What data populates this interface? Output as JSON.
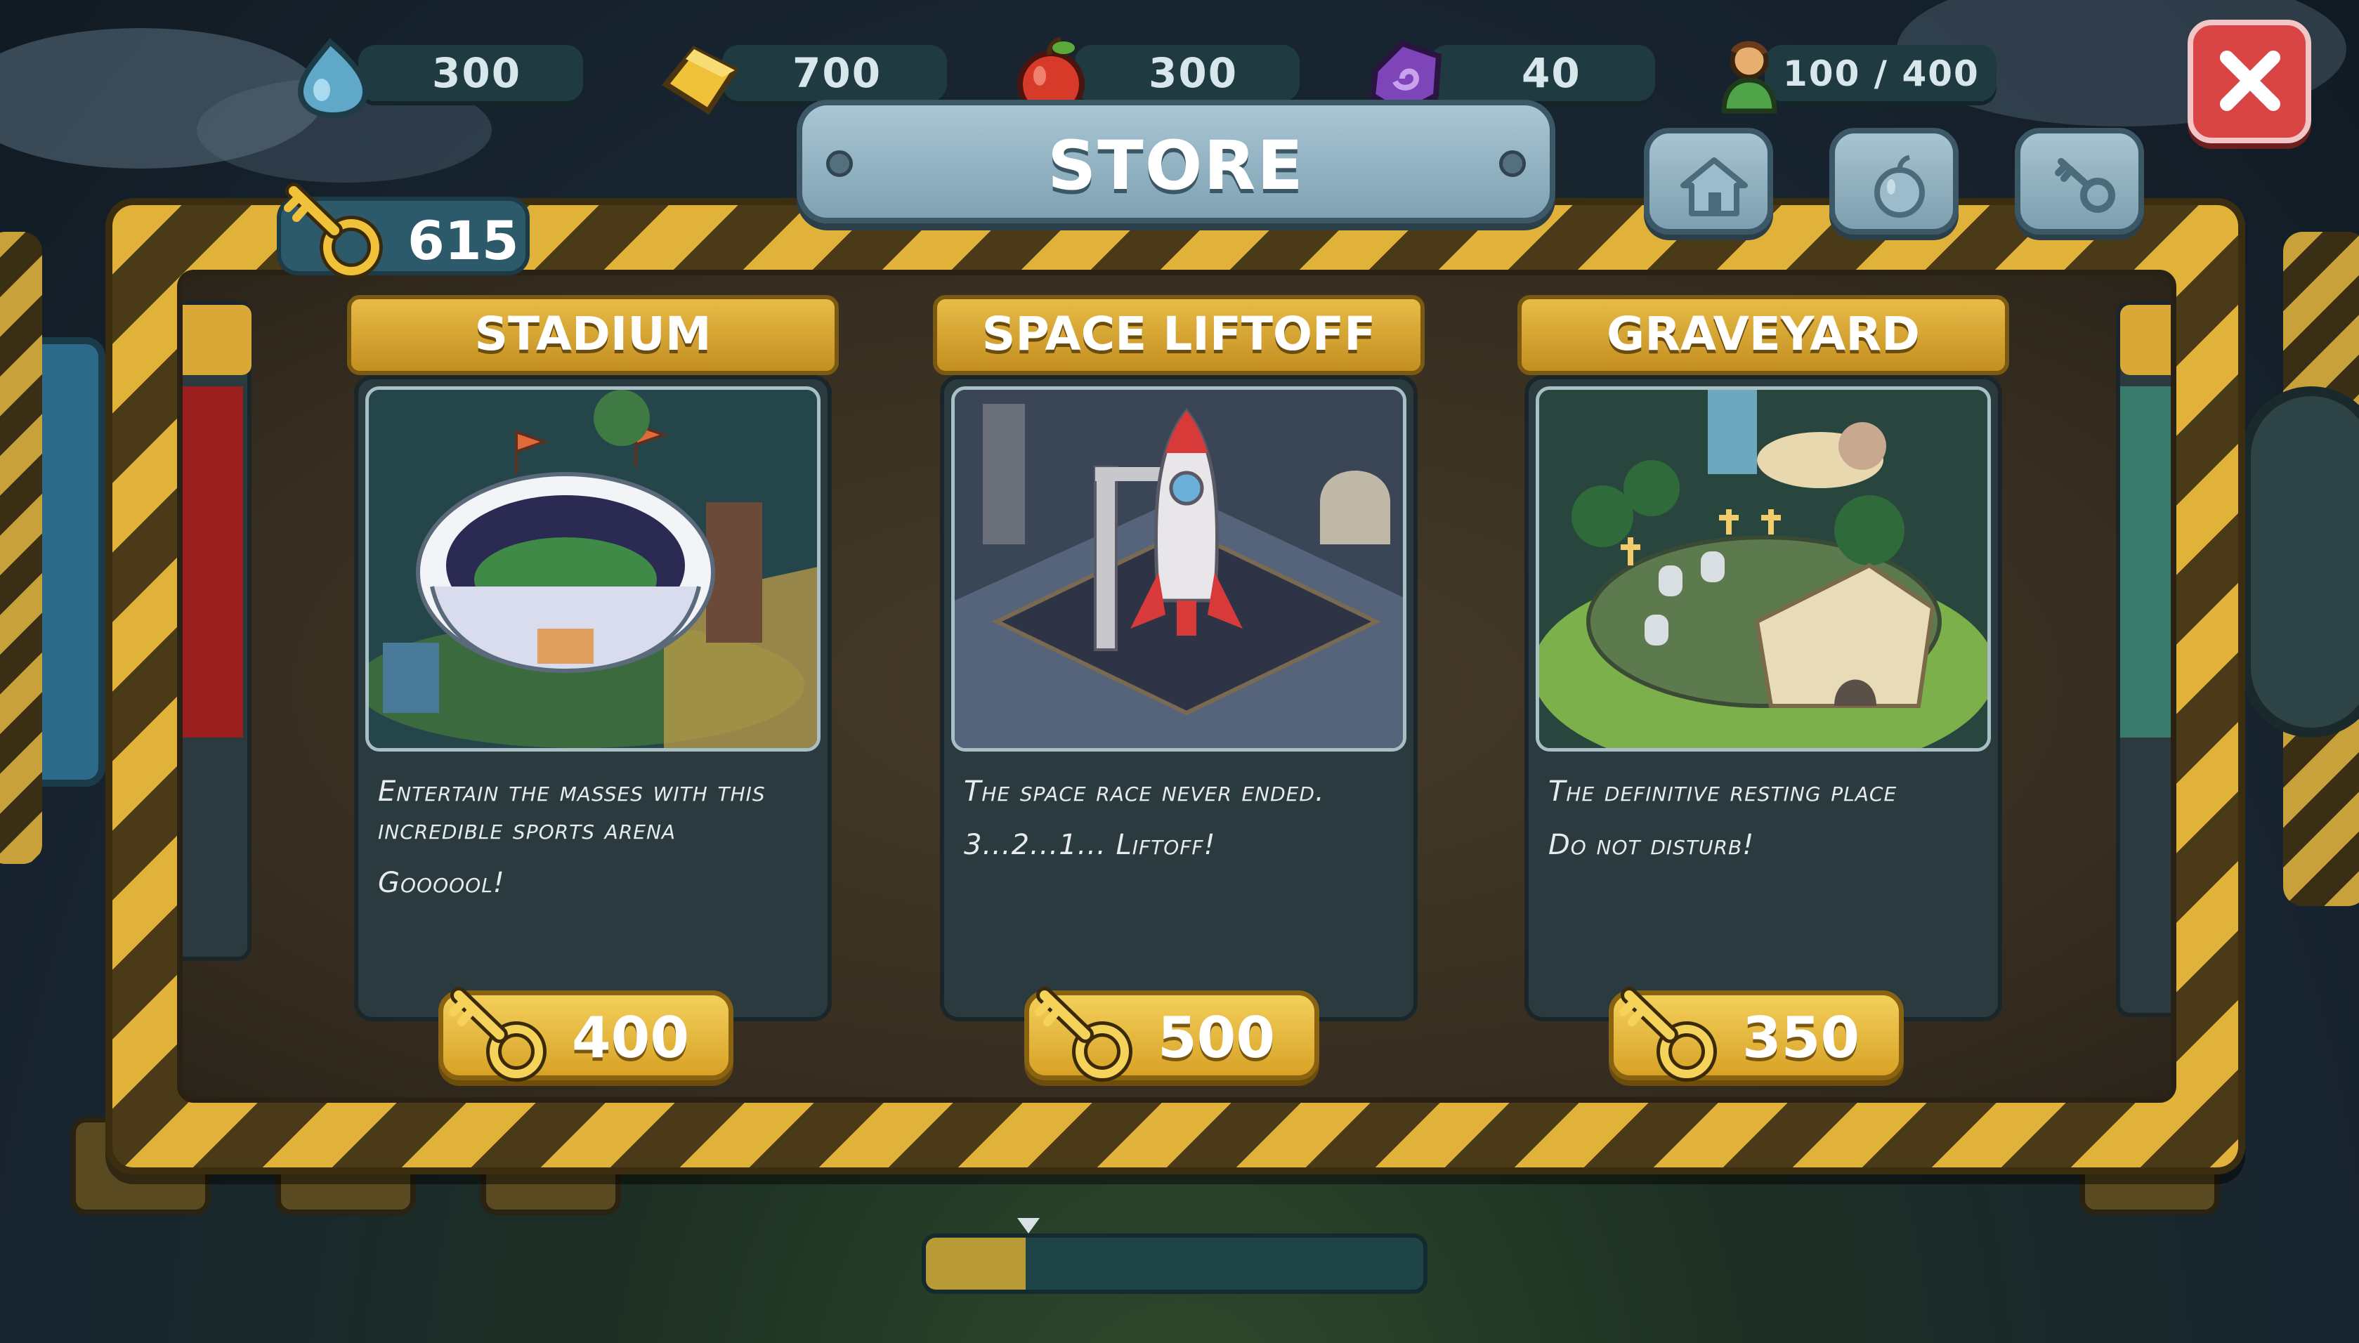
{
  "resources": [
    {
      "icon": "water-drop-icon",
      "value": "300"
    },
    {
      "icon": "gold-bar-icon",
      "value": "700"
    },
    {
      "icon": "apple-icon",
      "value": "300"
    },
    {
      "icon": "purple-crystal-icon",
      "value": "40"
    },
    {
      "icon": "population-icon",
      "value": "100 / 400"
    }
  ],
  "store": {
    "title": "STORE",
    "keys": "615",
    "tabs": [
      {
        "icon": "house-icon"
      },
      {
        "icon": "apple-icon"
      },
      {
        "icon": "key-icon"
      }
    ]
  },
  "cards": [
    {
      "title": "STADIUM",
      "desc": "Entertain the masses with this incredible sports arena",
      "desc2": "Goooool!",
      "price": "400"
    },
    {
      "title": "SPACE LIFTOFF",
      "desc": "The space race never ended.",
      "desc2": "3...2...1... Liftoff!",
      "price": "500"
    },
    {
      "title": "GRAVEYARD",
      "desc": "The definitive resting place",
      "desc2": "Do not disturb!",
      "price": "350"
    }
  ],
  "colors": {
    "accent_gold": "#e0b23a",
    "close_red": "#d94545",
    "panel_blue": "#a9c6d4"
  }
}
